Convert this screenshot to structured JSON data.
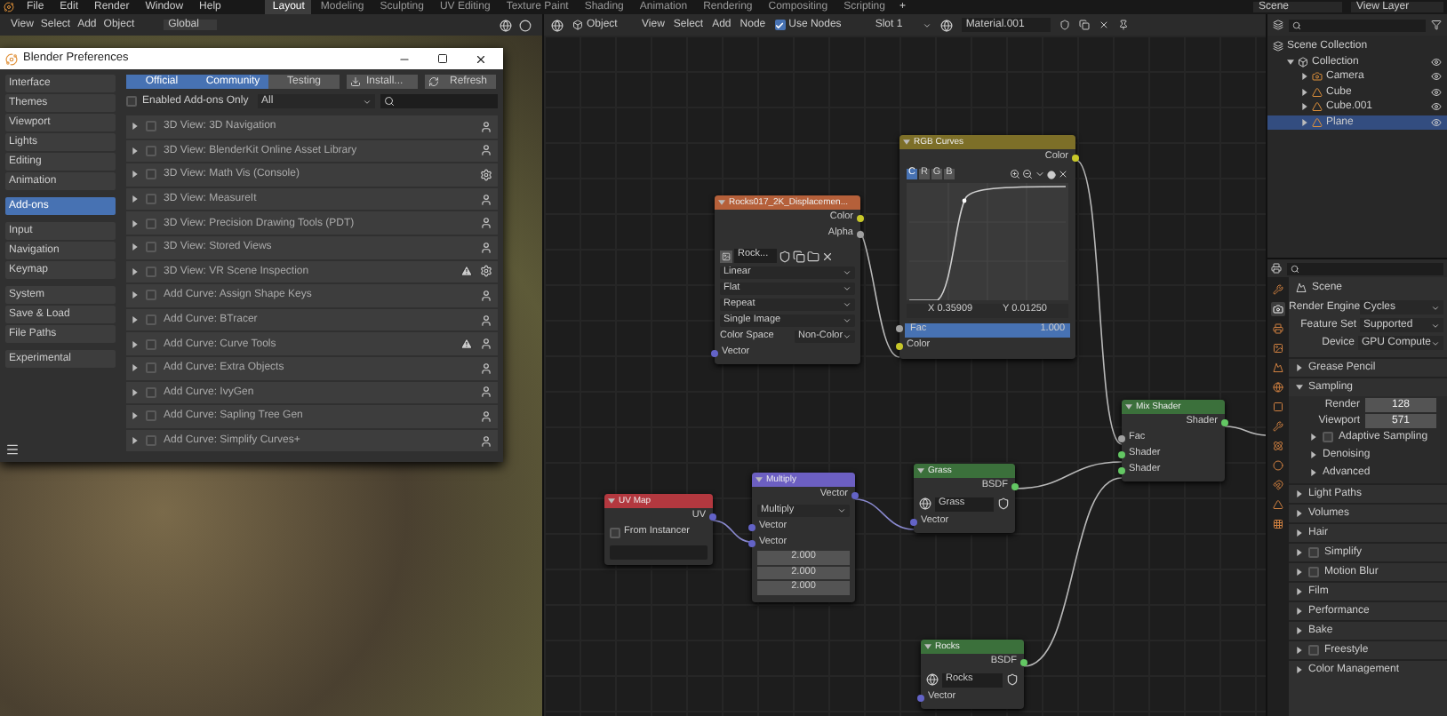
{
  "top_bar": {
    "menus": [
      "File",
      "Edit",
      "Render",
      "Window",
      "Help"
    ],
    "workspaces": [
      {
        "label": "Layout",
        "selected": true
      },
      {
        "label": "Modeling",
        "selected": false
      },
      {
        "label": "Sculpting",
        "selected": false
      },
      {
        "label": "UV Editing",
        "selected": false
      },
      {
        "label": "Texture Paint",
        "selected": false
      },
      {
        "label": "Shading",
        "selected": false
      },
      {
        "label": "Animation",
        "selected": false
      },
      {
        "label": "Rendering",
        "selected": false
      },
      {
        "label": "Compositing",
        "selected": false
      },
      {
        "label": "Scripting",
        "selected": false
      }
    ],
    "add_workspace": "+",
    "scene": "Scene",
    "view_layer": "View Layer"
  },
  "viewport": {
    "menus": [
      "View",
      "Select",
      "Add",
      "Object"
    ],
    "orientation": "Global"
  },
  "preferences": {
    "title": "Blender Preferences",
    "sidebar_groups": [
      {
        "items": [
          {
            "label": "Interface",
            "selected": false
          },
          {
            "label": "Themes",
            "selected": false
          },
          {
            "label": "Viewport",
            "selected": false
          },
          {
            "label": "Lights",
            "selected": false
          },
          {
            "label": "Editing",
            "selected": false
          },
          {
            "label": "Animation",
            "selected": false
          }
        ]
      },
      {
        "items": [
          {
            "label": "Add-ons",
            "selected": true
          }
        ]
      },
      {
        "items": [
          {
            "label": "Input",
            "selected": false
          },
          {
            "label": "Navigation",
            "selected": false
          },
          {
            "label": "Keymap",
            "selected": false
          }
        ]
      },
      {
        "items": [
          {
            "label": "System",
            "selected": false
          },
          {
            "label": "Save & Load",
            "selected": false
          },
          {
            "label": "File Paths",
            "selected": false
          }
        ]
      },
      {
        "items": [
          {
            "label": "Experimental",
            "selected": false
          }
        ]
      }
    ],
    "support_filters": [
      {
        "label": "Official",
        "on": true
      },
      {
        "label": "Community",
        "on": true
      },
      {
        "label": "Testing",
        "on": false
      }
    ],
    "install": "Install...",
    "refresh": "Refresh",
    "enabled_only": {
      "label": "Enabled Add-ons Only",
      "checked": false
    },
    "category": "All",
    "addons": [
      {
        "name": "3D View: 3D Navigation",
        "enabled": false,
        "warning": false,
        "kind": "community"
      },
      {
        "name": "3D View: BlenderKit Online Asset Library",
        "enabled": false,
        "warning": false,
        "kind": "community"
      },
      {
        "name": "3D View: Math Vis (Console)",
        "enabled": false,
        "warning": false,
        "kind": "official"
      },
      {
        "name": "3D View: MeasureIt",
        "enabled": false,
        "warning": false,
        "kind": "community"
      },
      {
        "name": "3D View: Precision Drawing Tools (PDT)",
        "enabled": false,
        "warning": false,
        "kind": "community"
      },
      {
        "name": "3D View: Stored Views",
        "enabled": false,
        "warning": false,
        "kind": "community"
      },
      {
        "name": "3D View: VR Scene Inspection",
        "enabled": false,
        "warning": true,
        "kind": "official"
      },
      {
        "name": "Add Curve: Assign Shape Keys",
        "enabled": false,
        "warning": false,
        "kind": "community"
      },
      {
        "name": "Add Curve: BTracer",
        "enabled": false,
        "warning": false,
        "kind": "community"
      },
      {
        "name": "Add Curve: Curve Tools",
        "enabled": false,
        "warning": true,
        "kind": "community"
      },
      {
        "name": "Add Curve: Extra Objects",
        "enabled": false,
        "warning": false,
        "kind": "community"
      },
      {
        "name": "Add Curve: IvyGen",
        "enabled": false,
        "warning": false,
        "kind": "community"
      },
      {
        "name": "Add Curve: Sapling Tree Gen",
        "enabled": false,
        "warning": false,
        "kind": "community"
      },
      {
        "name": "Add Curve: Simplify Curves+",
        "enabled": false,
        "warning": false,
        "kind": "community"
      }
    ]
  },
  "node_editor": {
    "object_mode": "Object",
    "menus": [
      "View",
      "Select",
      "Add",
      "Node"
    ],
    "use_nodes": {
      "label": "Use Nodes",
      "checked": true
    },
    "slot": "Slot 1",
    "material": "Material.001",
    "nodes": [
      {
        "title": "Rocks017_2K_Displacemen...",
        "color": "#b5603a",
        "rows": [
          {
            "kind": "output",
            "label": "Color",
            "color": "#c7c729"
          },
          {
            "kind": "output",
            "label": "Alpha",
            "color": "#a1a1a1"
          },
          {
            "kind": "image",
            "value": "Rock..."
          },
          {
            "kind": "dropdown",
            "value": "Linear"
          },
          {
            "kind": "dropdown",
            "value": "Flat"
          },
          {
            "kind": "dropdown",
            "value": "Repeat"
          },
          {
            "kind": "dropdown",
            "value": "Single Image"
          },
          {
            "kind": "labeled_dropdown",
            "label": "Color Space",
            "value": "Non-Color"
          },
          {
            "kind": "input",
            "label": "Vector",
            "color": "#6363c7"
          }
        ]
      },
      {
        "title": "RGB Curves",
        "color": "#7d6f28",
        "rows": [
          {
            "kind": "output",
            "label": "Color",
            "color": "#c7c729"
          },
          {
            "kind": "curve",
            "channels": [
              {
                "label": "C",
                "selected": true
              },
              {
                "label": "R",
                "selected": false
              },
              {
                "label": "G",
                "selected": false
              },
              {
                "label": "B",
                "selected": false
              }
            ],
            "x": "X 0.35909",
            "y": "Y 0.01250"
          },
          {
            "kind": "slider",
            "label": "Fac",
            "value": "1.000",
            "level": 1,
            "color": "#a1a1a1"
          },
          {
            "kind": "input",
            "label": "Color",
            "color": "#c7c729"
          }
        ]
      },
      {
        "title": "UV Map",
        "color": "#b3383f",
        "rows": [
          {
            "kind": "output",
            "label": "UV",
            "color": "#6363c7"
          },
          {
            "kind": "checkbox",
            "label": "From Instancer",
            "checked": false
          },
          {
            "kind": "field"
          }
        ]
      },
      {
        "title": "Multiply",
        "color": "#6c5fc2",
        "rows": [
          {
            "kind": "output",
            "label": "Vector",
            "color": "#6363c7"
          },
          {
            "kind": "dropdown",
            "value": "Multiply"
          },
          {
            "kind": "input",
            "label": "Vector",
            "color": "#6363c7"
          },
          {
            "kind": "vector",
            "label": "Vector",
            "color": "#6363c7",
            "values": [
              "2.000",
              "2.000",
              "2.000"
            ]
          }
        ]
      },
      {
        "title": "Grass",
        "color": "#3b703b",
        "rows": [
          {
            "kind": "output",
            "label": "BSDF",
            "color": "#63c763"
          },
          {
            "kind": "material",
            "value": "Grass"
          },
          {
            "kind": "input",
            "label": "Vector",
            "color": "#6363c7"
          }
        ]
      },
      {
        "title": "Mix Shader",
        "color": "#3b703b",
        "rows": [
          {
            "kind": "output",
            "label": "Shader",
            "color": "#63c763"
          },
          {
            "kind": "input",
            "label": "Fac",
            "color": "#a1a1a1"
          },
          {
            "kind": "input",
            "label": "Shader",
            "color": "#63c763"
          },
          {
            "kind": "input",
            "label": "Shader",
            "color": "#63c763"
          }
        ]
      },
      {
        "title": "Rocks",
        "color": "#3b703b",
        "rows": [
          {
            "kind": "output",
            "label": "BSDF",
            "color": "#63c763"
          },
          {
            "kind": "material",
            "value": "Rocks"
          },
          {
            "kind": "input",
            "label": "Vector",
            "color": "#6363c7"
          }
        ]
      }
    ]
  },
  "outliner": {
    "tree": [
      {
        "label": "Scene Collection",
        "kind": "scene",
        "children": [
          {
            "label": "Collection",
            "kind": "collection",
            "expanded": true,
            "selected": false,
            "children": [
              {
                "label": "Camera",
                "kind": "camera",
                "selected": false
              },
              {
                "label": "Cube",
                "kind": "mesh",
                "selected": false
              },
              {
                "label": "Cube.001",
                "kind": "mesh",
                "selected": false
              },
              {
                "label": "Plane",
                "kind": "mesh",
                "selected": true
              }
            ]
          }
        ]
      }
    ]
  },
  "properties": {
    "tabs": [
      {
        "selected": false
      },
      {
        "selected": true
      },
      {
        "selected": false
      },
      {
        "selected": false
      },
      {
        "selected": false
      },
      {
        "selected": false
      },
      {
        "selected": false
      },
      {
        "selected": false
      },
      {
        "selected": false
      },
      {
        "selected": false
      },
      {
        "selected": false
      },
      {
        "selected": false
      },
      {
        "selected": false
      }
    ],
    "title": "Scene",
    "fields": [
      {
        "label": "Render Engine",
        "value": "Cycles"
      },
      {
        "label": "Feature Set",
        "value": "Supported"
      },
      {
        "label": "Device",
        "value": "GPU Compute"
      }
    ],
    "panels": [
      {
        "label": "Grease Pencil",
        "expanded": false
      },
      {
        "label": "Sampling",
        "expanded": true,
        "fields": [
          {
            "label": "Render",
            "value": "128"
          },
          {
            "label": "Viewport",
            "value": "571"
          }
        ],
        "children": [
          {
            "label": "Adaptive Sampling",
            "expanded": false,
            "checked": false
          },
          {
            "label": "Denoising",
            "expanded": false
          },
          {
            "label": "Advanced",
            "expanded": false
          }
        ]
      },
      {
        "label": "Light Paths",
        "expanded": false
      },
      {
        "label": "Volumes",
        "expanded": false
      },
      {
        "label": "Hair",
        "expanded": false
      },
      {
        "label": "Simplify",
        "expanded": false,
        "checked": false
      },
      {
        "label": "Motion Blur",
        "expanded": false,
        "checked": false
      },
      {
        "label": "Film",
        "expanded": false
      },
      {
        "label": "Performance",
        "expanded": false
      },
      {
        "label": "Bake",
        "expanded": false
      },
      {
        "label": "Freestyle",
        "expanded": false,
        "checked": false
      },
      {
        "label": "Color Management",
        "expanded": false
      }
    ]
  }
}
